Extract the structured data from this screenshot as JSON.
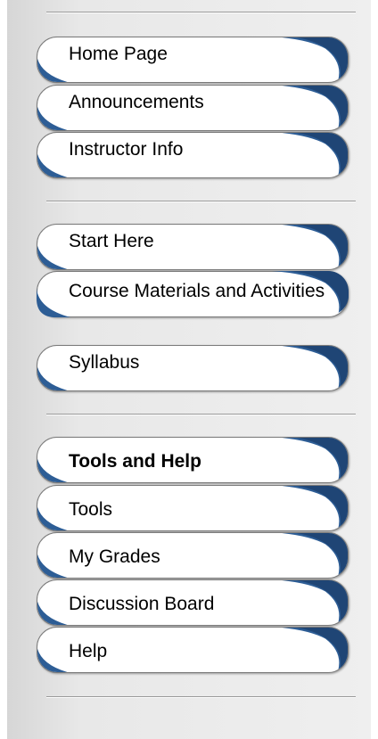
{
  "menu": {
    "groups": [
      {
        "items": [
          {
            "label": "Home Page"
          },
          {
            "label": "Announcements"
          },
          {
            "label": "Instructor Info"
          }
        ]
      },
      {
        "items": [
          {
            "label": "Start Here"
          },
          {
            "label": "Course Materials and Activities"
          },
          {
            "label": "Syllabus"
          }
        ]
      },
      {
        "items": [
          {
            "label": "Tools and Help"
          },
          {
            "label": "Tools"
          },
          {
            "label": "My Grades"
          },
          {
            "label": "Discussion Board"
          },
          {
            "label": "Help"
          }
        ]
      }
    ]
  },
  "colors": {
    "swoosh_blue": "#2d5d95",
    "swoosh_dark": "#1f4575",
    "background": "#e8e8e8"
  }
}
